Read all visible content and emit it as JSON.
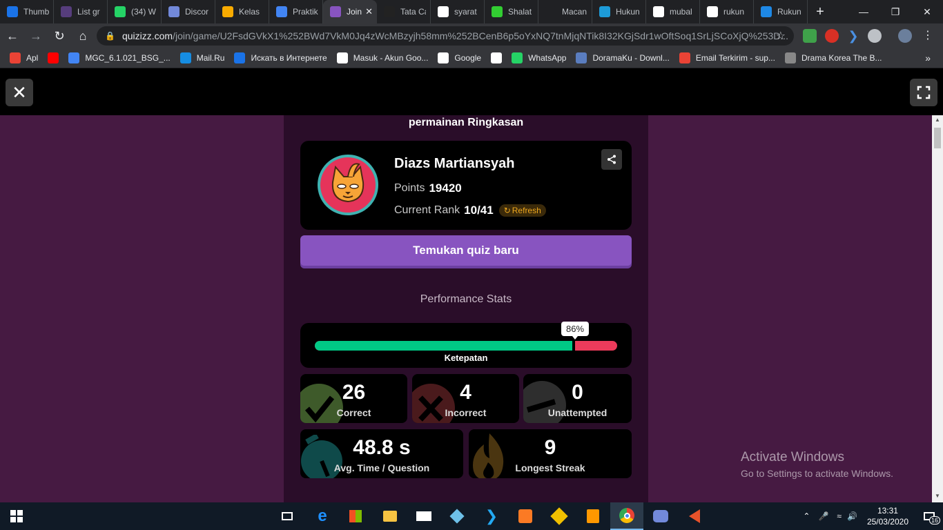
{
  "browser": {
    "tabs": [
      {
        "label": "Thumb",
        "icon": "flag-icon",
        "color": "#1a73e8"
      },
      {
        "label": "List gr",
        "icon": "bootstrap-icon",
        "color": "#563d7c"
      },
      {
        "label": "(34) W",
        "icon": "whatsapp-icon",
        "color": "#25d366"
      },
      {
        "label": "Discor",
        "icon": "discord-icon",
        "color": "#7289da"
      },
      {
        "label": "Kelas",
        "icon": "classroom-icon",
        "color": "#f9ab00"
      },
      {
        "label": "Praktik",
        "icon": "slides-icon",
        "color": "#4285f4"
      },
      {
        "label": "Join",
        "icon": "quizizz-icon",
        "color": "#8854c0",
        "active": true
      },
      {
        "label": "Tata Ca",
        "icon": "p-icon",
        "color": "#222"
      },
      {
        "label": "syarat",
        "icon": "google-icon",
        "color": "#fff"
      },
      {
        "label": "Shalat",
        "icon": "green-square-icon",
        "color": "#32cd32"
      },
      {
        "label": "Macan",
        "icon": "search-icon",
        "color": "#202124"
      },
      {
        "label": "Hukun",
        "icon": "shield-icon",
        "color": "#1d9bd8"
      },
      {
        "label": "mubal",
        "icon": "google-icon",
        "color": "#fff"
      },
      {
        "label": "rukun",
        "icon": "google-icon",
        "color": "#fff"
      },
      {
        "label": "Rukun",
        "icon": "spinner-icon",
        "color": "#1e88e5"
      }
    ],
    "close_tab": "✕",
    "new_tab": "+",
    "url_host": "quizizz.com",
    "url_path": "/join/game/U2FsdGVkX1%252BWd7VkM0Jq4zWcMBzyjh58mm%252BCenB6p5oYxNQ7tnMjqNTik8I32KGjSdr1wOftSoq1SrLjSCoXjQ%253D...",
    "bookmarks": [
      {
        "label": "Apl",
        "icon": "apps-icon",
        "color": "#ea4335"
      },
      {
        "label": "",
        "icon": "youtube-icon",
        "color": "#ff0000"
      },
      {
        "label": "MGC_6.1.021_BSG_...",
        "icon": "doc-icon",
        "color": "#4285f4"
      },
      {
        "label": "Mail.Ru",
        "icon": "mailru-icon",
        "color": "#168de2"
      },
      {
        "label": "Искать в Интернете",
        "icon": "search-icon",
        "color": "#1a73e8"
      },
      {
        "label": "Masuk - Akun Goo...",
        "icon": "google-icon",
        "color": "#fff"
      },
      {
        "label": "Google",
        "icon": "google-icon",
        "color": "#fff"
      },
      {
        "label": "",
        "icon": "google-icon",
        "color": "#fff"
      },
      {
        "label": "WhatsApp",
        "icon": "whatsapp-icon",
        "color": "#25d366"
      },
      {
        "label": "DoramaKu - Downl...",
        "icon": "dorama-icon",
        "color": "#5a7dbf"
      },
      {
        "label": "Email Terkirim - sup...",
        "icon": "gmail-icon",
        "color": "#ea4335"
      },
      {
        "label": "Drama Korea The B...",
        "icon": "spiral-icon",
        "color": "#888"
      }
    ],
    "bookmarks_more": "»"
  },
  "game": {
    "summary_title": "permainan Ringkasan",
    "player": {
      "name": "Diazs Martiansyah",
      "points_label": "Points",
      "points": "19420",
      "rank_label": "Current Rank",
      "rank": "10/41",
      "refresh_label": "Refresh"
    },
    "new_quiz_label": "Temukan quiz baru",
    "perf_title": "Performance Stats",
    "accuracy": {
      "percent": 86,
      "percent_label": "86%",
      "label": "Ketepatan"
    },
    "stats": {
      "correct": {
        "value": "26",
        "label": "Correct"
      },
      "incorrect": {
        "value": "4",
        "label": "Incorrect"
      },
      "unattempted": {
        "value": "0",
        "label": "Unattempted"
      },
      "avg_time": {
        "value": "48.8 s",
        "label": "Avg. Time / Question"
      },
      "streak": {
        "value": "9",
        "label": "Longest Streak"
      }
    }
  },
  "activate": {
    "line1": "Activate Windows",
    "line2": "Go to Settings to activate Windows."
  },
  "taskbar": {
    "time": "13:31",
    "date": "25/03/2020",
    "notif_count": "16"
  },
  "colors": {
    "correct": "#00c985",
    "incorrect": "#ec3b5b",
    "brand": "#8854c0",
    "page_bg": "#461a42"
  }
}
